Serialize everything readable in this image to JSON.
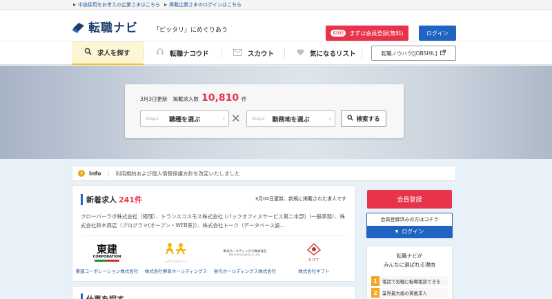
{
  "topbar": {
    "links": [
      "中途採用をお考えの企業さまはこちら",
      "掲載企業さまのログインはこちら"
    ]
  },
  "header": {
    "logo_text": "転職ナビ",
    "tagline": "「ピッタリ」にめぐりあう",
    "register_badge": "60秒",
    "register_label": "まずは会員登録(無料)",
    "login_label": "ログイン"
  },
  "nav": {
    "items": [
      {
        "label": "求人を探す",
        "icon": "search-icon"
      },
      {
        "label": "転職ナコウド",
        "icon": "headset-icon"
      },
      {
        "label": "スカウト",
        "icon": "mail-icon"
      },
      {
        "label": "気になるリスト",
        "icon": "heart-icon"
      }
    ],
    "external_label": "転職ノウハウ[JOBSHIL]"
  },
  "search": {
    "updated": "3月3日更新",
    "count_label": "掲載求人数",
    "count": "10,810",
    "count_unit": "件",
    "job_step": "Step1",
    "job_label": "職種を選ぶ",
    "area_step": "Step2",
    "area_label": "勤務地を選ぶ",
    "search_label": "検索する"
  },
  "info": {
    "tag": "Info",
    "text": "利用規約および個人情報保護方針を改定いたしました"
  },
  "new_jobs": {
    "title": "新着求人",
    "count": "241件",
    "meta": "3月04日更新、新規に掲載された求人です",
    "description": "クローバーラボ株式会社（経理）、トランスコスモス株式会社 (バックオフィスサービス第二本部)（一般事務）、株式会社鈴木商店（プログラマ(オープン・WEB系)）、株式会社トーク（データベース設…",
    "companies": [
      {
        "logo_text": "東建",
        "logo_sub": "CORPORATION",
        "name": "東建コーポレーション株式会社"
      },
      {
        "logo_text": "ムゲンエステート",
        "name": "株式会社夢真ホールディングス"
      },
      {
        "logo_text": "栄光ホールディングス株式会社",
        "logo_sub": "EIKOH HOLDINGS CO.,LTD.",
        "name": "栄光ホールディングス株式会社"
      },
      {
        "logo_text": "GIFT",
        "name": "株式会社ギフト"
      }
    ]
  },
  "job_search_section": {
    "title": "仕事を探す"
  },
  "sidebar": {
    "register_label": "会員登録",
    "member_note": "会員登録済みの方はコチラ",
    "login_label": "ログイン",
    "reasons_title_1": "転職ナビが",
    "reasons_title_2": "みんなに選ばれる理由",
    "reasons": [
      {
        "num": "1",
        "text": "電話で気軽に転職相談できる"
      },
      {
        "num": "2",
        "text": "業界最大級の掲載求人"
      }
    ]
  },
  "colors": {
    "brand_blue": "#2064c2",
    "accent_red": "#e8334a",
    "nav_active": "#fdf6d4"
  }
}
